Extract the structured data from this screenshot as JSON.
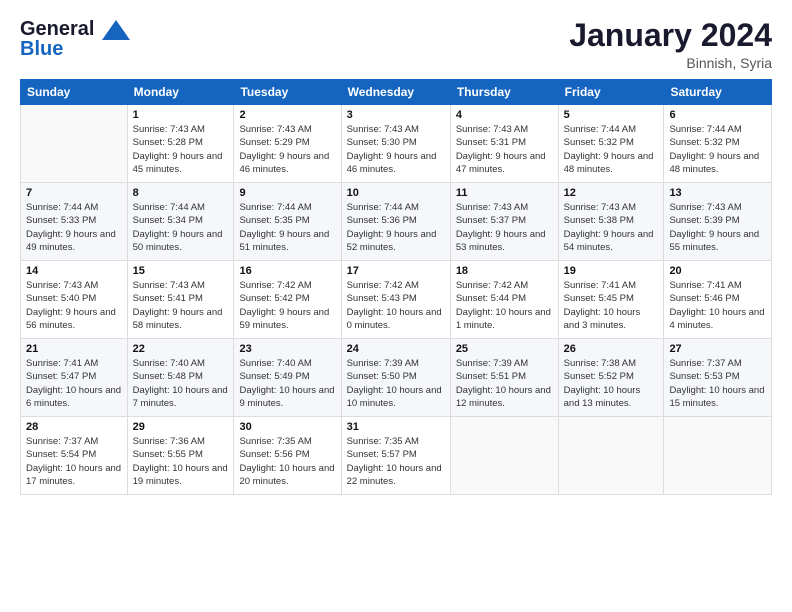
{
  "logo": {
    "line1": "General",
    "line2": "Blue"
  },
  "title": "January 2024",
  "location": "Binnish, Syria",
  "days_of_week": [
    "Sunday",
    "Monday",
    "Tuesday",
    "Wednesday",
    "Thursday",
    "Friday",
    "Saturday"
  ],
  "weeks": [
    [
      {
        "day": "",
        "sunrise": "",
        "sunset": "",
        "daylight": ""
      },
      {
        "day": "1",
        "sunrise": "Sunrise: 7:43 AM",
        "sunset": "Sunset: 5:28 PM",
        "daylight": "Daylight: 9 hours and 45 minutes."
      },
      {
        "day": "2",
        "sunrise": "Sunrise: 7:43 AM",
        "sunset": "Sunset: 5:29 PM",
        "daylight": "Daylight: 9 hours and 46 minutes."
      },
      {
        "day": "3",
        "sunrise": "Sunrise: 7:43 AM",
        "sunset": "Sunset: 5:30 PM",
        "daylight": "Daylight: 9 hours and 46 minutes."
      },
      {
        "day": "4",
        "sunrise": "Sunrise: 7:43 AM",
        "sunset": "Sunset: 5:31 PM",
        "daylight": "Daylight: 9 hours and 47 minutes."
      },
      {
        "day": "5",
        "sunrise": "Sunrise: 7:44 AM",
        "sunset": "Sunset: 5:32 PM",
        "daylight": "Daylight: 9 hours and 48 minutes."
      },
      {
        "day": "6",
        "sunrise": "Sunrise: 7:44 AM",
        "sunset": "Sunset: 5:32 PM",
        "daylight": "Daylight: 9 hours and 48 minutes."
      }
    ],
    [
      {
        "day": "7",
        "sunrise": "Sunrise: 7:44 AM",
        "sunset": "Sunset: 5:33 PM",
        "daylight": "Daylight: 9 hours and 49 minutes."
      },
      {
        "day": "8",
        "sunrise": "Sunrise: 7:44 AM",
        "sunset": "Sunset: 5:34 PM",
        "daylight": "Daylight: 9 hours and 50 minutes."
      },
      {
        "day": "9",
        "sunrise": "Sunrise: 7:44 AM",
        "sunset": "Sunset: 5:35 PM",
        "daylight": "Daylight: 9 hours and 51 minutes."
      },
      {
        "day": "10",
        "sunrise": "Sunrise: 7:44 AM",
        "sunset": "Sunset: 5:36 PM",
        "daylight": "Daylight: 9 hours and 52 minutes."
      },
      {
        "day": "11",
        "sunrise": "Sunrise: 7:43 AM",
        "sunset": "Sunset: 5:37 PM",
        "daylight": "Daylight: 9 hours and 53 minutes."
      },
      {
        "day": "12",
        "sunrise": "Sunrise: 7:43 AM",
        "sunset": "Sunset: 5:38 PM",
        "daylight": "Daylight: 9 hours and 54 minutes."
      },
      {
        "day": "13",
        "sunrise": "Sunrise: 7:43 AM",
        "sunset": "Sunset: 5:39 PM",
        "daylight": "Daylight: 9 hours and 55 minutes."
      }
    ],
    [
      {
        "day": "14",
        "sunrise": "Sunrise: 7:43 AM",
        "sunset": "Sunset: 5:40 PM",
        "daylight": "Daylight: 9 hours and 56 minutes."
      },
      {
        "day": "15",
        "sunrise": "Sunrise: 7:43 AM",
        "sunset": "Sunset: 5:41 PM",
        "daylight": "Daylight: 9 hours and 58 minutes."
      },
      {
        "day": "16",
        "sunrise": "Sunrise: 7:42 AM",
        "sunset": "Sunset: 5:42 PM",
        "daylight": "Daylight: 9 hours and 59 minutes."
      },
      {
        "day": "17",
        "sunrise": "Sunrise: 7:42 AM",
        "sunset": "Sunset: 5:43 PM",
        "daylight": "Daylight: 10 hours and 0 minutes."
      },
      {
        "day": "18",
        "sunrise": "Sunrise: 7:42 AM",
        "sunset": "Sunset: 5:44 PM",
        "daylight": "Daylight: 10 hours and 1 minute."
      },
      {
        "day": "19",
        "sunrise": "Sunrise: 7:41 AM",
        "sunset": "Sunset: 5:45 PM",
        "daylight": "Daylight: 10 hours and 3 minutes."
      },
      {
        "day": "20",
        "sunrise": "Sunrise: 7:41 AM",
        "sunset": "Sunset: 5:46 PM",
        "daylight": "Daylight: 10 hours and 4 minutes."
      }
    ],
    [
      {
        "day": "21",
        "sunrise": "Sunrise: 7:41 AM",
        "sunset": "Sunset: 5:47 PM",
        "daylight": "Daylight: 10 hours and 6 minutes."
      },
      {
        "day": "22",
        "sunrise": "Sunrise: 7:40 AM",
        "sunset": "Sunset: 5:48 PM",
        "daylight": "Daylight: 10 hours and 7 minutes."
      },
      {
        "day": "23",
        "sunrise": "Sunrise: 7:40 AM",
        "sunset": "Sunset: 5:49 PM",
        "daylight": "Daylight: 10 hours and 9 minutes."
      },
      {
        "day": "24",
        "sunrise": "Sunrise: 7:39 AM",
        "sunset": "Sunset: 5:50 PM",
        "daylight": "Daylight: 10 hours and 10 minutes."
      },
      {
        "day": "25",
        "sunrise": "Sunrise: 7:39 AM",
        "sunset": "Sunset: 5:51 PM",
        "daylight": "Daylight: 10 hours and 12 minutes."
      },
      {
        "day": "26",
        "sunrise": "Sunrise: 7:38 AM",
        "sunset": "Sunset: 5:52 PM",
        "daylight": "Daylight: 10 hours and 13 minutes."
      },
      {
        "day": "27",
        "sunrise": "Sunrise: 7:37 AM",
        "sunset": "Sunset: 5:53 PM",
        "daylight": "Daylight: 10 hours and 15 minutes."
      }
    ],
    [
      {
        "day": "28",
        "sunrise": "Sunrise: 7:37 AM",
        "sunset": "Sunset: 5:54 PM",
        "daylight": "Daylight: 10 hours and 17 minutes."
      },
      {
        "day": "29",
        "sunrise": "Sunrise: 7:36 AM",
        "sunset": "Sunset: 5:55 PM",
        "daylight": "Daylight: 10 hours and 19 minutes."
      },
      {
        "day": "30",
        "sunrise": "Sunrise: 7:35 AM",
        "sunset": "Sunset: 5:56 PM",
        "daylight": "Daylight: 10 hours and 20 minutes."
      },
      {
        "day": "31",
        "sunrise": "Sunrise: 7:35 AM",
        "sunset": "Sunset: 5:57 PM",
        "daylight": "Daylight: 10 hours and 22 minutes."
      },
      {
        "day": "",
        "sunrise": "",
        "sunset": "",
        "daylight": ""
      },
      {
        "day": "",
        "sunrise": "",
        "sunset": "",
        "daylight": ""
      },
      {
        "day": "",
        "sunrise": "",
        "sunset": "",
        "daylight": ""
      }
    ]
  ]
}
